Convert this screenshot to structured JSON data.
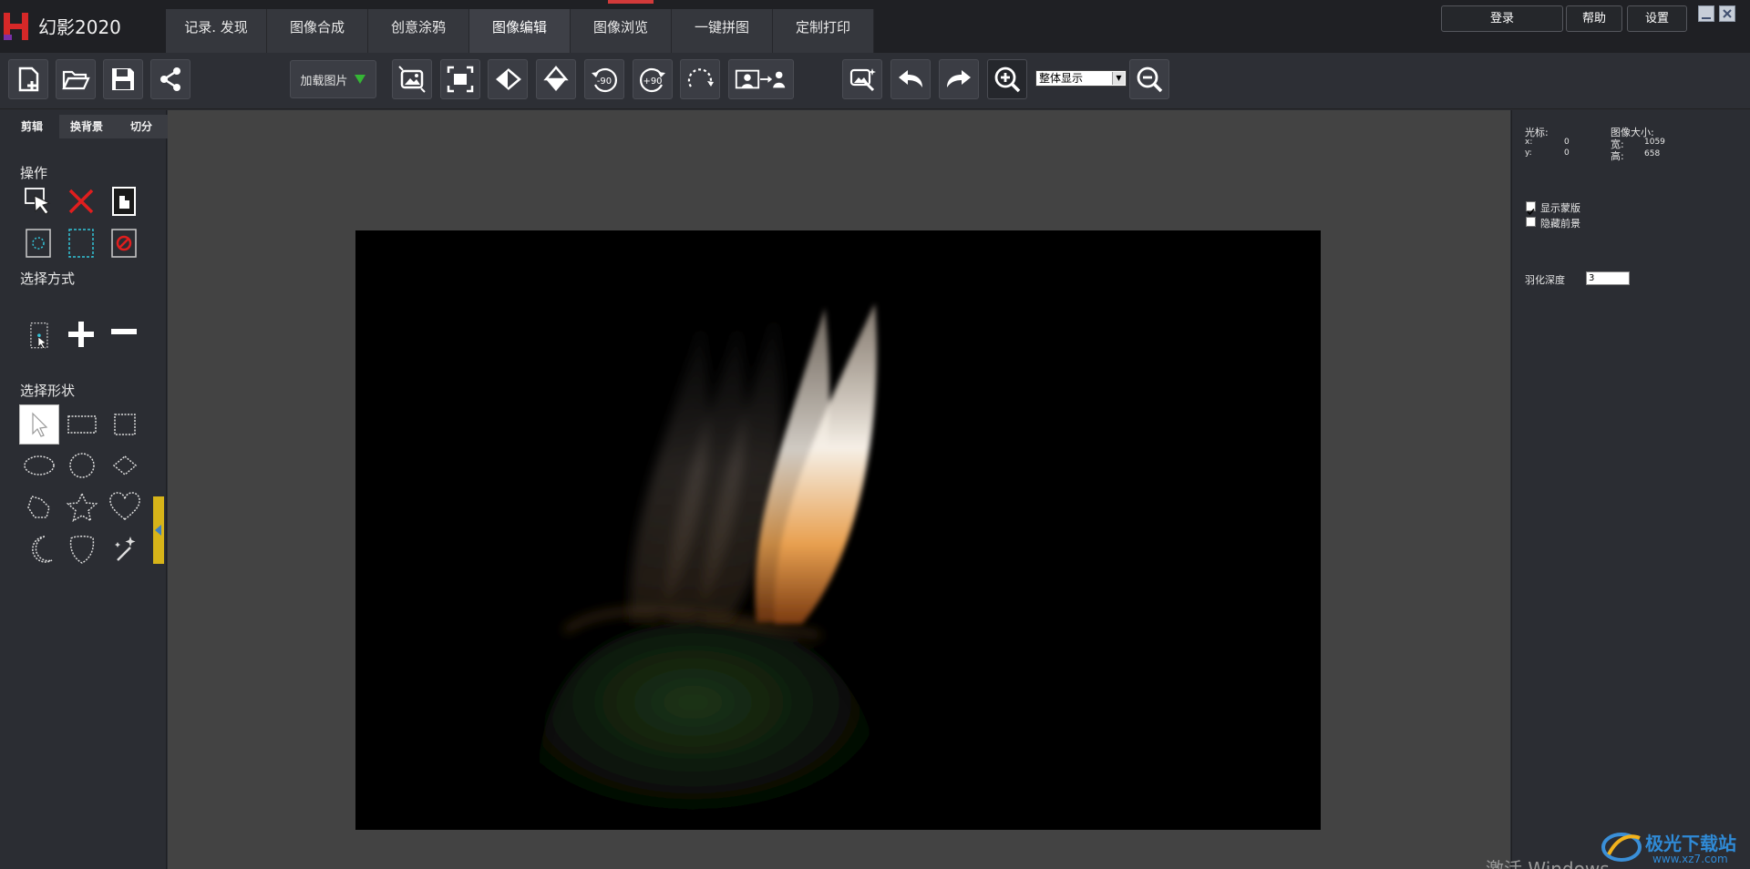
{
  "app": {
    "title": "幻影2020",
    "tabs": [
      {
        "label": "记录. 发现",
        "active": false
      },
      {
        "label": "图像合成",
        "active": false
      },
      {
        "label": "创意涂鸦",
        "active": false
      },
      {
        "label": "图像编辑",
        "active": true
      },
      {
        "label": "图像浏览",
        "active": false
      },
      {
        "label": "一键拼图",
        "active": false
      },
      {
        "label": "定制打印",
        "active": false
      }
    ],
    "top_buttons": {
      "login": "登录",
      "help": "帮助",
      "settings": "设置"
    }
  },
  "toolbar": {
    "load_image_label": "加载图片",
    "zoom_mode": "整体显示",
    "icons": [
      "new-file-icon",
      "open-folder-icon",
      "save-icon",
      "share-icon",
      "fit-image-icon",
      "actual-size-icon",
      "flip-horizontal-icon",
      "flip-vertical-icon",
      "rotate-minus-90-icon",
      "rotate-plus-90-icon",
      "free-rotate-icon",
      "portrait-replace-icon",
      "auto-enhance-icon",
      "undo-icon",
      "redo-icon",
      "zoom-in-icon",
      "zoom-out-icon"
    ]
  },
  "left_panel": {
    "tabs": [
      {
        "label": "剪辑",
        "active": true
      },
      {
        "label": "换背景",
        "active": false
      },
      {
        "label": "切分",
        "active": false
      }
    ],
    "operation_title": "操作",
    "selection_mode_title": "选择方式",
    "selection_shape_title": "选择形状"
  },
  "right_panel": {
    "cursor_label": "光标:",
    "x_label": "x:",
    "x_value": "0",
    "y_label": "y:",
    "y_value": "0",
    "image_size_label": "图像大小:",
    "width_label": "宽:",
    "width_value": "1059",
    "height_label": "高:",
    "height_value": "658",
    "show_mask_label": "显示蒙版",
    "show_mask_checked": true,
    "hide_foreground_label": "隐藏前景",
    "hide_foreground_checked": false,
    "feather_depth_label": "羽化深度",
    "feather_depth_value": "3"
  },
  "overlay": {
    "activation_text": "激活 Windows",
    "brand_name": "极光下载站",
    "brand_url": "www.xz7.com"
  },
  "colors": {
    "accent_red": "#d23a3a",
    "panel": "#2b2d33",
    "canvas": "#434343",
    "handle": "#d7b419"
  }
}
